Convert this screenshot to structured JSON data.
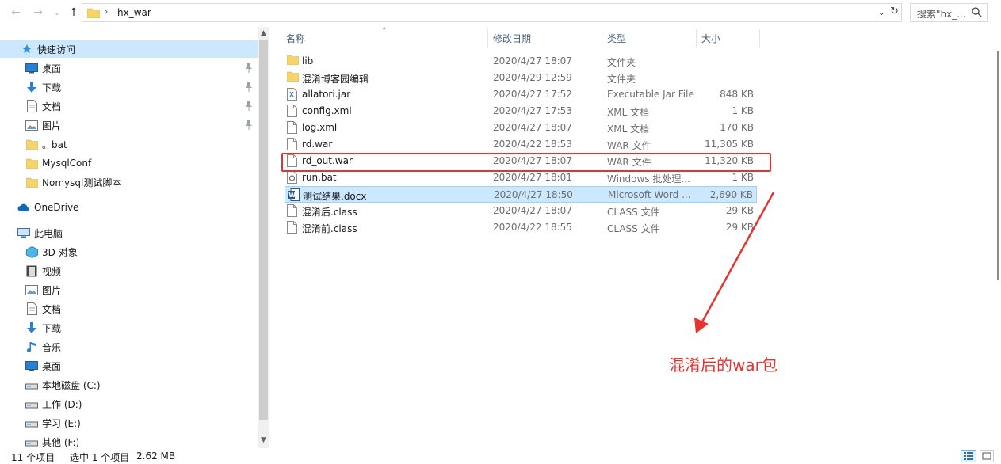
{
  "address": {
    "path": "hx_war",
    "separator": "›"
  },
  "search": {
    "placeholder": "搜索\"hx_..."
  },
  "nav": {
    "quick_access": "快速访问",
    "quick_items": [
      {
        "label": "桌面",
        "icon": "desktop-icon",
        "pinned": true
      },
      {
        "label": "下载",
        "icon": "download-icon",
        "pinned": true
      },
      {
        "label": "文档",
        "icon": "document-icon",
        "pinned": true
      },
      {
        "label": "图片",
        "icon": "picture-icon",
        "pinned": true
      },
      {
        "label": "。bat",
        "icon": "folder-icon",
        "pinned": false
      },
      {
        "label": "MysqlConf",
        "icon": "folder-icon",
        "pinned": false
      },
      {
        "label": "Nomysql测试脚本",
        "icon": "folder-icon",
        "pinned": false
      }
    ],
    "onedrive": "OneDrive",
    "this_pc": "此电脑",
    "pc_items": [
      {
        "label": "3D 对象",
        "icon": "3d-objects-icon"
      },
      {
        "label": "视频",
        "icon": "video-icon"
      },
      {
        "label": "图片",
        "icon": "picture-icon"
      },
      {
        "label": "文档",
        "icon": "document-icon"
      },
      {
        "label": "下载",
        "icon": "download-icon"
      },
      {
        "label": "音乐",
        "icon": "music-icon"
      },
      {
        "label": "桌面",
        "icon": "desktop-icon"
      },
      {
        "label": "本地磁盘 (C:)",
        "icon": "drive-icon"
      },
      {
        "label": "工作 (D:)",
        "icon": "drive-icon"
      },
      {
        "label": "学习 (E:)",
        "icon": "drive-icon"
      },
      {
        "label": "其他 (F:)",
        "icon": "drive-icon"
      }
    ]
  },
  "columns": {
    "name": "名称",
    "date": "修改日期",
    "type": "类型",
    "size": "大小"
  },
  "files": [
    {
      "name": "lib",
      "date": "2020/4/27 18:07",
      "type": "文件夹",
      "size": "",
      "icon": "folder-icon"
    },
    {
      "name": "混淆博客园编辑",
      "date": "2020/4/29 12:59",
      "type": "文件夹",
      "size": "",
      "icon": "folder-icon"
    },
    {
      "name": "allatori.jar",
      "date": "2020/4/27 17:52",
      "type": "Executable Jar File",
      "size": "848 KB",
      "icon": "jar-icon"
    },
    {
      "name": "config.xml",
      "date": "2020/4/27 17:53",
      "type": "XML 文档",
      "size": "1 KB",
      "icon": "file-icon"
    },
    {
      "name": "log.xml",
      "date": "2020/4/27 18:07",
      "type": "XML 文档",
      "size": "170 KB",
      "icon": "file-icon"
    },
    {
      "name": "rd.war",
      "date": "2020/4/22 18:53",
      "type": "WAR 文件",
      "size": "11,305 KB",
      "icon": "file-icon"
    },
    {
      "name": "rd_out.war",
      "date": "2020/4/27 18:07",
      "type": "WAR 文件",
      "size": "11,320 KB",
      "icon": "file-icon"
    },
    {
      "name": "run.bat",
      "date": "2020/4/27 18:01",
      "type": "Windows 批处理...",
      "size": "1 KB",
      "icon": "bat-icon"
    },
    {
      "name": "测试结果.docx",
      "date": "2020/4/27 18:50",
      "type": "Microsoft Word ...",
      "size": "2,690 KB",
      "icon": "word-icon",
      "selected": true
    },
    {
      "name": "混淆后.class",
      "date": "2020/4/27 18:07",
      "type": "CLASS 文件",
      "size": "29 KB",
      "icon": "file-icon"
    },
    {
      "name": "混淆前.class",
      "date": "2020/4/22 18:55",
      "type": "CLASS 文件",
      "size": "29 KB",
      "icon": "file-icon"
    }
  ],
  "annotation": {
    "text": "混淆后的war包",
    "color": "#e3342f"
  },
  "status": {
    "count": "11 个项目",
    "selected": "选中 1 个项目",
    "size": "2.62 MB"
  },
  "colors": {
    "selection": "#cce8ff",
    "accent": "#e3342f",
    "folder": "#f6d36b"
  }
}
